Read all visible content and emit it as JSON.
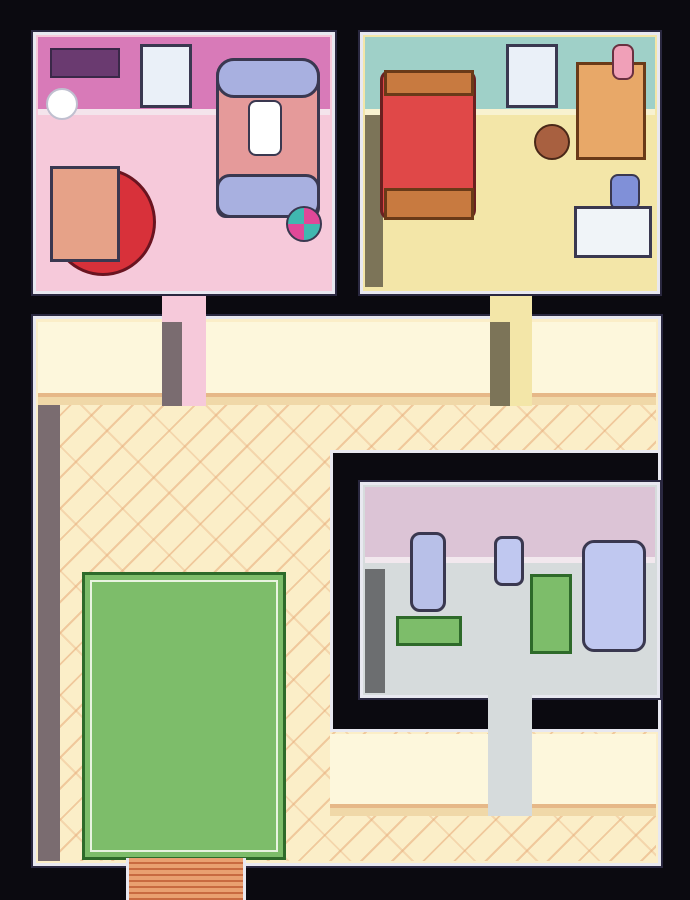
{
  "scene": {
    "name": "house-floor-map"
  },
  "rooms": [
    {
      "id": "pink-bedroom",
      "wall_color": "#d87ab8",
      "floor_color": "#f6c9da"
    },
    {
      "id": "yellow-bedroom",
      "wall_color": "#9fd0c8",
      "floor_color": "#f3e6a8"
    },
    {
      "id": "bathroom",
      "wall_color": "#dcc4d6",
      "floor_color": "#d6dbdc"
    },
    {
      "id": "hallway",
      "floor_color": "#fbeec8"
    }
  ],
  "colors": {
    "rug_green": "#7dbd6a",
    "rug_red": "#d8313a",
    "bed_red": "#e04848",
    "stairs": "#e9a070"
  }
}
